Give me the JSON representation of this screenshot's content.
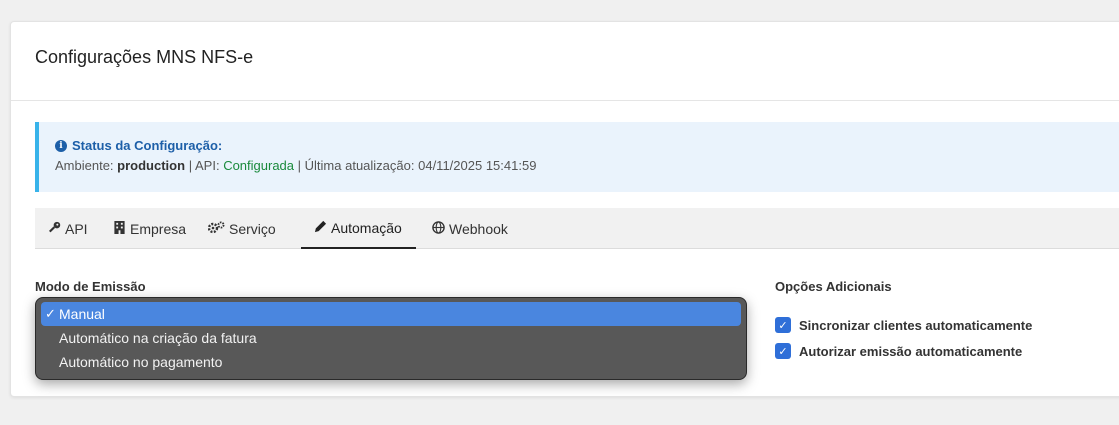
{
  "card": {
    "title": "Configurações MNS NFS-e"
  },
  "status": {
    "title": "Status da Configuração:",
    "env_label": "Ambiente:",
    "env_value": "production",
    "sep1": "|",
    "api_label": "API:",
    "api_value": "Configurada",
    "sep2": "|",
    "updated_label": "Última atualização:",
    "updated_value": "04/11/2025 15:41:59"
  },
  "tabs": [
    {
      "label": "API",
      "icon": "key-icon",
      "active": false
    },
    {
      "label": "Empresa",
      "icon": "building-icon",
      "active": false
    },
    {
      "label": "Serviço",
      "icon": "cogs-icon",
      "active": false
    },
    {
      "label": "Automação",
      "icon": "pencil-icon",
      "active": true
    },
    {
      "label": "Webhook",
      "icon": "globe-icon",
      "active": false
    }
  ],
  "emission": {
    "label": "Modo de Emissão",
    "options": [
      "Manual",
      "Automático na criação da fatura",
      "Automático no pagamento"
    ],
    "selected": "Manual"
  },
  "additional": {
    "label": "Opções Adicionais",
    "options": [
      {
        "label": "Sincronizar clientes automaticamente",
        "checked": true
      },
      {
        "label": "Autorizar emissão automaticamente",
        "checked": true
      }
    ]
  },
  "colors": {
    "accent": "#2f6fd8",
    "alert_border": "#38b3ea",
    "selected_option": "#4a86df",
    "ok": "#1a8a3c"
  }
}
